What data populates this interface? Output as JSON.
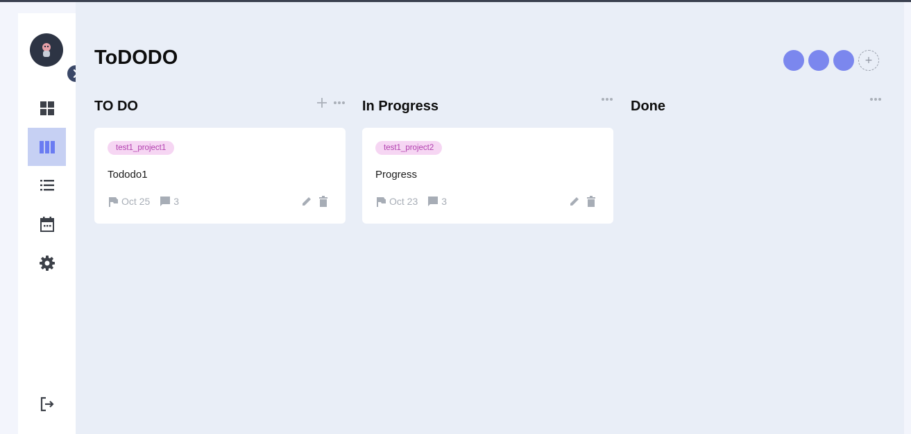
{
  "app": {
    "title": "ToDODO"
  },
  "sidebar": {
    "items": [
      {
        "name": "dashboard",
        "icon": "dashboard-icon",
        "active": false
      },
      {
        "name": "board",
        "icon": "board-icon",
        "active": true
      },
      {
        "name": "list",
        "icon": "list-icon",
        "active": false
      },
      {
        "name": "calendar",
        "icon": "calendar-icon",
        "active": false
      },
      {
        "name": "settings",
        "icon": "gear-icon",
        "active": false
      }
    ],
    "logout_icon": "logout-icon"
  },
  "members": {
    "count": 3,
    "color": "#7b87ee",
    "add_label": "+"
  },
  "columns": [
    {
      "title": "TO DO",
      "cards": [
        {
          "tag": "test1_project1",
          "title": "Tododo1",
          "due": "Oct 25",
          "comments": "3"
        }
      ]
    },
    {
      "title": "In Progress",
      "cards": [
        {
          "tag": "test1_project2",
          "title": "Progress",
          "due": "Oct 23",
          "comments": "3"
        }
      ]
    },
    {
      "title": "Done",
      "cards": []
    }
  ],
  "colors": {
    "accent": "#7b87ee",
    "active_nav": "#c6d0f3",
    "tag_bg": "#f6d6f3",
    "tag_text": "#b13fae",
    "background": "#e9eef7"
  }
}
